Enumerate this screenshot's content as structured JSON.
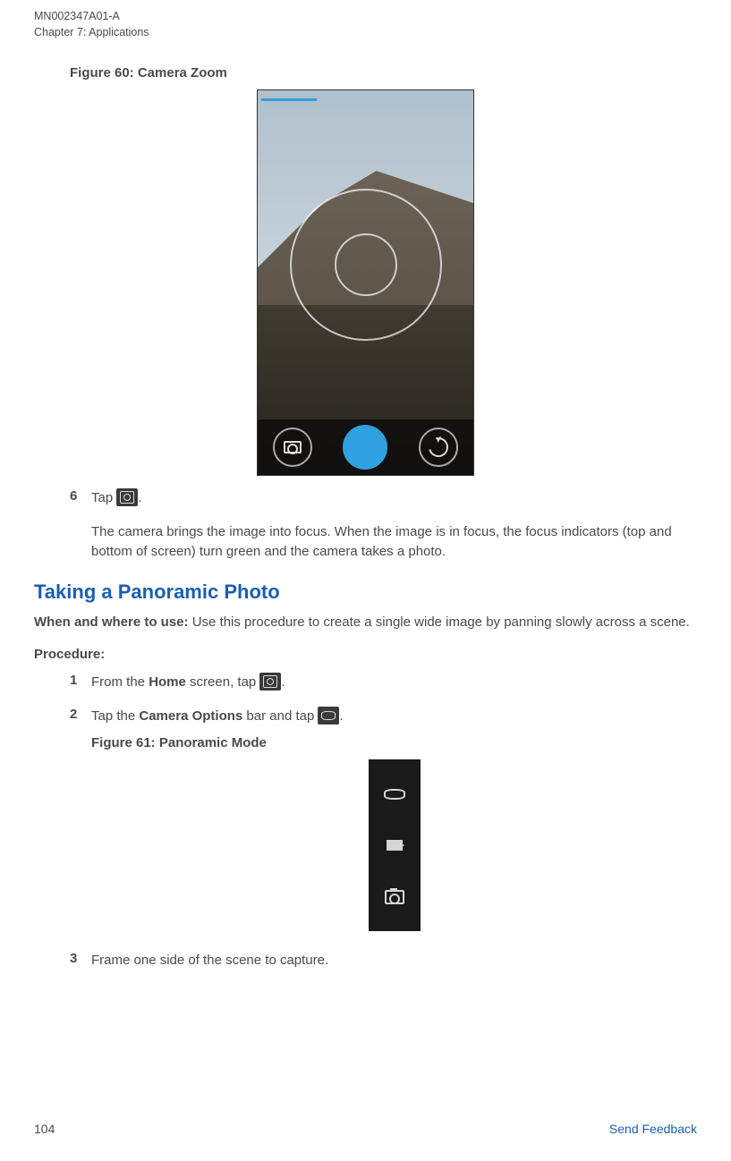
{
  "header": {
    "doc_id": "MN002347A01-A",
    "chapter": "Chapter 7:  Applications"
  },
  "fig60_caption": "Figure 60: Camera Zoom",
  "step6": {
    "num": "6",
    "tap_prefix": "Tap ",
    "tap_suffix": ".",
    "cont": "The camera brings the image into focus. When the image is in focus, the focus indicators (top and bottom of screen) turn green and the camera takes a photo."
  },
  "section_title": "Taking a Panoramic Photo",
  "intro_bold": "When and where to use: ",
  "intro_rest": "Use this procedure to create a single wide image by panning slowly across a scene.",
  "procedure_label": "Procedure:",
  "step1": {
    "num": "1",
    "pre": "From the ",
    "bold": "Home",
    "mid": " screen, tap ",
    "suffix": "."
  },
  "step2": {
    "num": "2",
    "pre": "Tap the ",
    "bold": "Camera Options",
    "mid": " bar and tap ",
    "suffix": ".",
    "fig_caption": "Figure 61: Panoramic Mode"
  },
  "step3": {
    "num": "3",
    "text": "Frame one side of the scene to capture."
  },
  "footer": {
    "page_num": "104",
    "feedback": "Send Feedback"
  }
}
